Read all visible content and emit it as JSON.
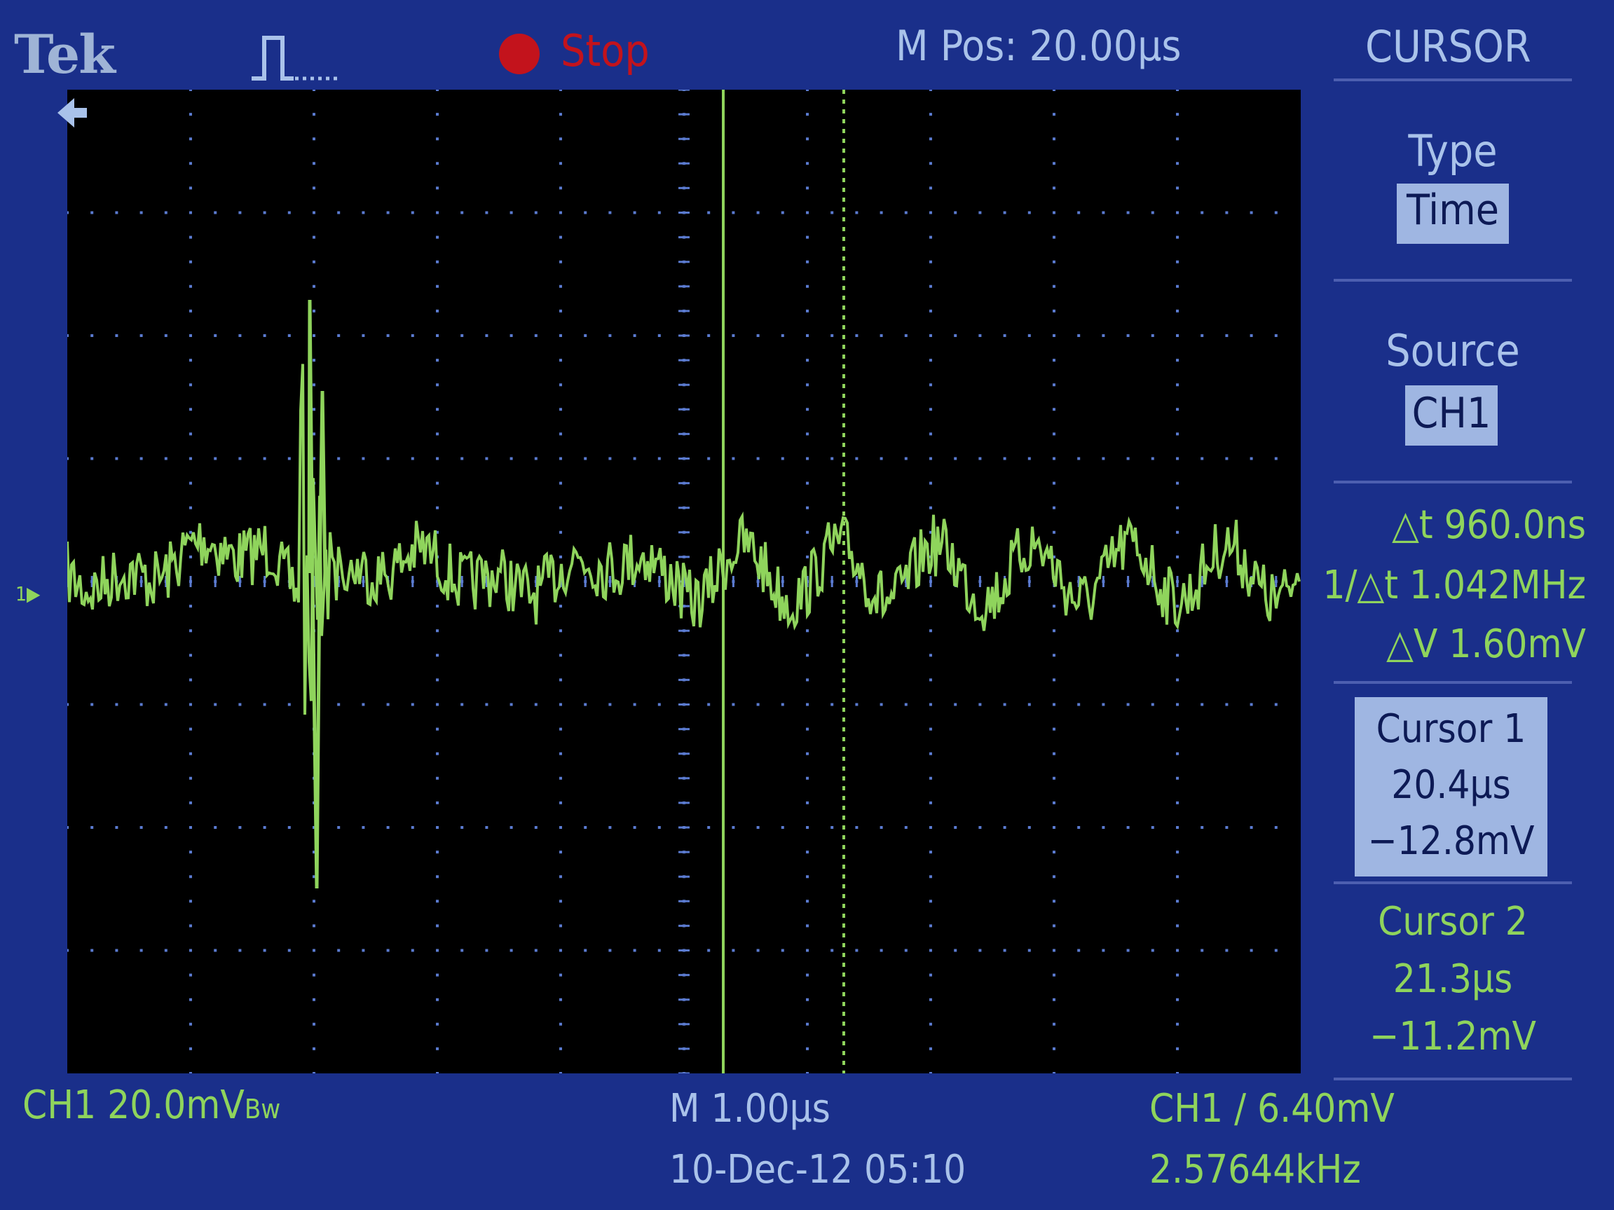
{
  "header": {
    "brand": "Tek",
    "acquisition_icon": "acquisition-pulse-icon",
    "run_state": "Stop",
    "run_state_icon": "stop-dot-icon",
    "horizontal_position": "M Pos: 20.00µs",
    "menu_title": "CURSOR"
  },
  "side_menu": {
    "type_label": "Type",
    "type_value": "Time",
    "source_label": "Source",
    "source_value": "CH1",
    "delta_t": "△t 960.0ns",
    "inv_delta_t": "1/△t 1.042MHz",
    "delta_v": "△V 1.60mV",
    "cursor1": {
      "label": "Cursor 1",
      "time": "20.4µs",
      "voltage": "−12.8mV"
    },
    "cursor2": {
      "label": "Cursor 2",
      "time": "21.3µs",
      "voltage": "−11.2mV"
    }
  },
  "channel_marker": "1",
  "status_bar": {
    "ch1_scale": "CH1  20.0mV",
    "bandwidth_icon": "Bw",
    "timebase": "M 1.00µs",
    "date_time": "10-Dec-12 05:10",
    "trigger": "CH1 ∕ 6.40mV",
    "frequency": "2.57644kHz"
  },
  "colors": {
    "bezel": "#1a2f8a",
    "trace": "#8fd45c",
    "menu_text": "#a9c2ea",
    "highlight_box": "#9fb6e2",
    "stop_red": "#c3131c",
    "graticule_dots": "#5b7bd0"
  }
}
